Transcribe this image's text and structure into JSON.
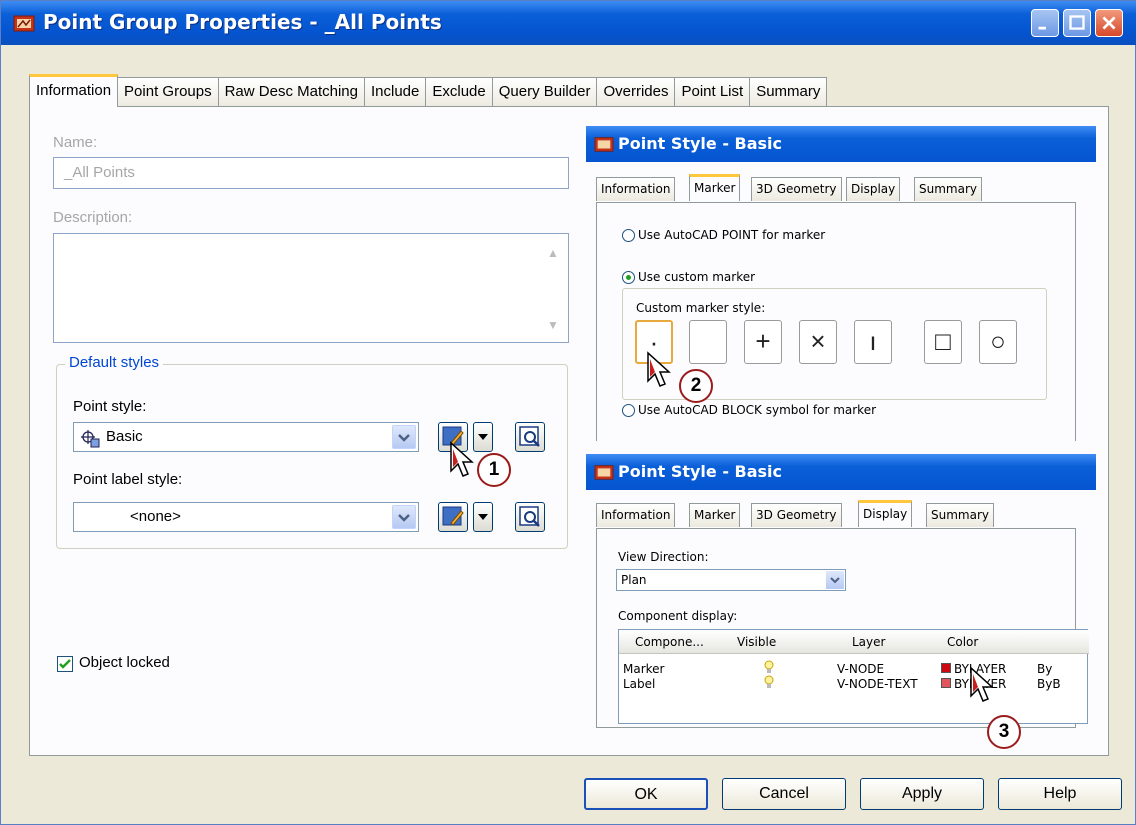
{
  "window": {
    "title": "Point Group Properties - _All Points"
  },
  "tabs": [
    "Information",
    "Point Groups",
    "Raw Desc Matching",
    "Include",
    "Exclude",
    "Query Builder",
    "Overrides",
    "Point List",
    "Summary"
  ],
  "info": {
    "name_label": "Name:",
    "name_value": "_All Points",
    "description_label": "Description:",
    "default_styles_title": "Default styles",
    "point_style_label": "Point style:",
    "point_style_value": "Basic",
    "point_label_style_label": "Point label style:",
    "point_label_style_value": "<none>",
    "object_locked_label": "Object locked",
    "object_locked_checked": true
  },
  "buttons": {
    "ok": "OK",
    "cancel": "Cancel",
    "apply": "Apply",
    "help": "Help"
  },
  "marker_inset": {
    "title": "Point Style - Basic",
    "tabs": [
      "Information",
      "Marker",
      "3D Geometry",
      "Display",
      "Summary"
    ],
    "active_tab": "Marker",
    "option_point": "Use AutoCAD POINT for marker",
    "option_custom": "Use custom marker",
    "custom_style_label": "Custom marker style:",
    "option_block": "Use AutoCAD BLOCK symbol for marker",
    "markers": [
      "·",
      "",
      "+",
      "×",
      "ı",
      "□",
      "○"
    ]
  },
  "display_inset": {
    "title": "Point Style - Basic",
    "tabs": [
      "Information",
      "Marker",
      "3D Geometry",
      "Display",
      "Summary"
    ],
    "active_tab": "Display",
    "view_direction_label": "View Direction:",
    "view_direction_value": "Plan",
    "component_display_label": "Component display:",
    "columns": [
      "Compone...",
      "Visible",
      "Layer",
      "Color"
    ],
    "rows": [
      {
        "component": "Marker",
        "layer": "V-NODE",
        "color": "BYLAYER",
        "extra": "By"
      },
      {
        "component": "Label",
        "layer": "V-NODE-TEXT",
        "color": "BYLAYER",
        "extra": "ByB"
      }
    ],
    "swatch_colors": [
      "#cc0a14",
      "#e2555d"
    ]
  },
  "callouts": [
    "1",
    "2",
    "3"
  ]
}
